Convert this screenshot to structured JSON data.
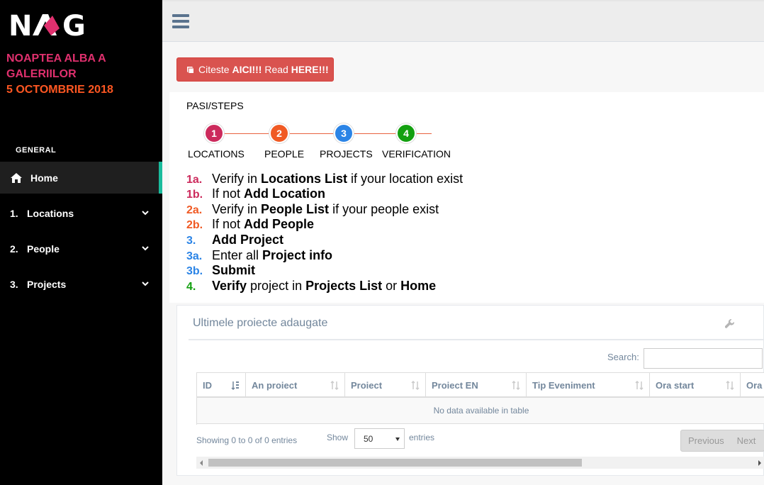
{
  "sidebar": {
    "logo_text": "NAG",
    "event_title_line1": "NOAPTEA ALBA A",
    "event_title_line2": "GALERIILOR",
    "event_date": "5 OCTOMBRIE 2018",
    "section_label": "GENERAL",
    "home_label": "Home",
    "items": [
      {
        "num": "1.",
        "label": "Locations"
      },
      {
        "num": "2.",
        "label": "People"
      },
      {
        "num": "3.",
        "label": "Projects"
      }
    ],
    "colors": {
      "title_pink": "#e0306e",
      "title_orange": "#ff5722",
      "active_border": "#1abb9c"
    }
  },
  "header": {
    "read_button": {
      "prefix": "Citeste ",
      "bold1": "AICI!!!",
      "mid": " Read ",
      "bold2": "HERE!!!"
    }
  },
  "steps": {
    "title": "PASI/STEPS",
    "items": [
      {
        "num": "1",
        "label": "LOCATIONS",
        "color": "#cc2a5c"
      },
      {
        "num": "2",
        "label": "PEOPLE",
        "color": "#f05a24"
      },
      {
        "num": "3",
        "label": "PROJECTS",
        "color": "#2b84e6"
      },
      {
        "num": "4",
        "label": "VERIFICATION",
        "color": "#13a010"
      }
    ],
    "instructions": [
      {
        "code": "1a.",
        "color": "#cc2a5c",
        "pre": "Verify in ",
        "bold": "Locations List",
        "post": " if your location exist",
        "bold2": "",
        "post2": ""
      },
      {
        "code": "1b.",
        "color": "#cc2a5c",
        "pre": "If not ",
        "bold": "Add Location",
        "post": "",
        "bold2": "",
        "post2": ""
      },
      {
        "code": "2a.",
        "color": "#f05a24",
        "pre": "Verify in ",
        "bold": "People List",
        "post": " if your people exist",
        "bold2": "",
        "post2": ""
      },
      {
        "code": "2b.",
        "color": "#f05a24",
        "pre": "If not ",
        "bold": "Add People",
        "post": "",
        "bold2": "",
        "post2": ""
      },
      {
        "code": "3.",
        "color": "#2b84e6",
        "pre": "",
        "bold": "Add Project",
        "post": "",
        "bold2": "",
        "post2": ""
      },
      {
        "code": "3a.",
        "color": "#2b84e6",
        "pre": "Enter all ",
        "bold": "Project info",
        "post": "",
        "bold2": "",
        "post2": ""
      },
      {
        "code": "3b.",
        "color": "#2b84e6",
        "pre": "",
        "bold": "Submit",
        "post": "",
        "bold2": "",
        "post2": ""
      },
      {
        "code": "4.",
        "color": "#13a010",
        "pre": "",
        "bold": "Verify",
        "post": " project in ",
        "bold2": "Projects List",
        "post2": " or ",
        "bold3": "Home"
      }
    ]
  },
  "projects_table": {
    "panel_title": "Ultimele proiecte adaugate",
    "search_label": "Search:",
    "search_value": "",
    "columns": [
      "ID",
      "An proiect",
      "Proiect",
      "Proiect EN",
      "Tip Eveniment",
      "Ora start",
      "Ora"
    ],
    "empty_message": "No data available in table",
    "info": "Showing 0 to 0 of 0 entries",
    "show_label": "Show",
    "page_size": "50",
    "entries_label": "entries",
    "prev_label": "Previous",
    "next_label": "Next"
  }
}
